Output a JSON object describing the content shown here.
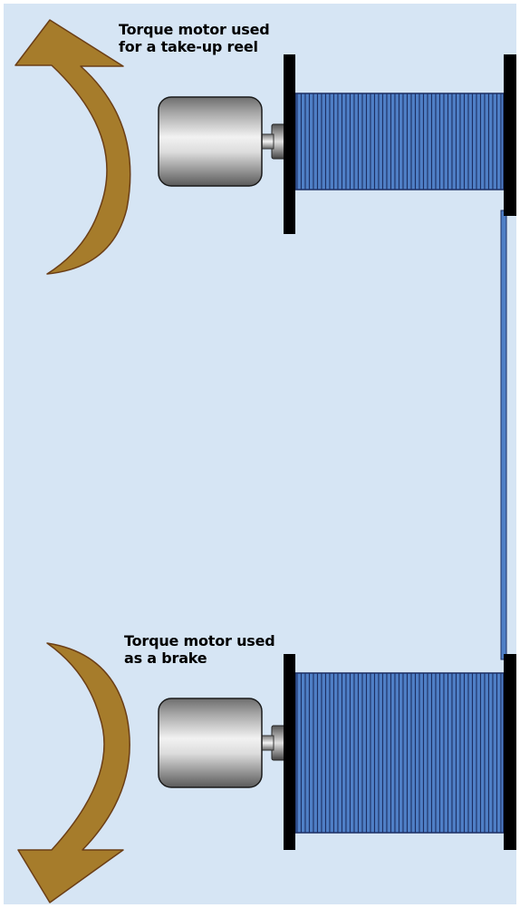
{
  "diagram": {
    "top_label": {
      "line1": "Torque motor used",
      "line2": "for a take-up reel"
    },
    "bottom_label": {
      "line1": "Torque motor used",
      "line2": "as a brake"
    },
    "colors": {
      "background": "#d6e5f4",
      "border": "#ffffff",
      "arrow_fill": "#a67c2b",
      "arrow_stroke": "#6b3e16",
      "tape_blue": "#4f7fc6",
      "tape_dark": "#1c2f63",
      "flange": "#000000",
      "motor_light": "#e6e6e6",
      "motor_dark": "#6e6e6e"
    },
    "components": [
      "take-up-reel-motor",
      "take-up-reel",
      "rotation-arrow-counterclockwise",
      "brake-motor",
      "supply-reel",
      "rotation-arrow-clockwise",
      "tape-path"
    ]
  }
}
